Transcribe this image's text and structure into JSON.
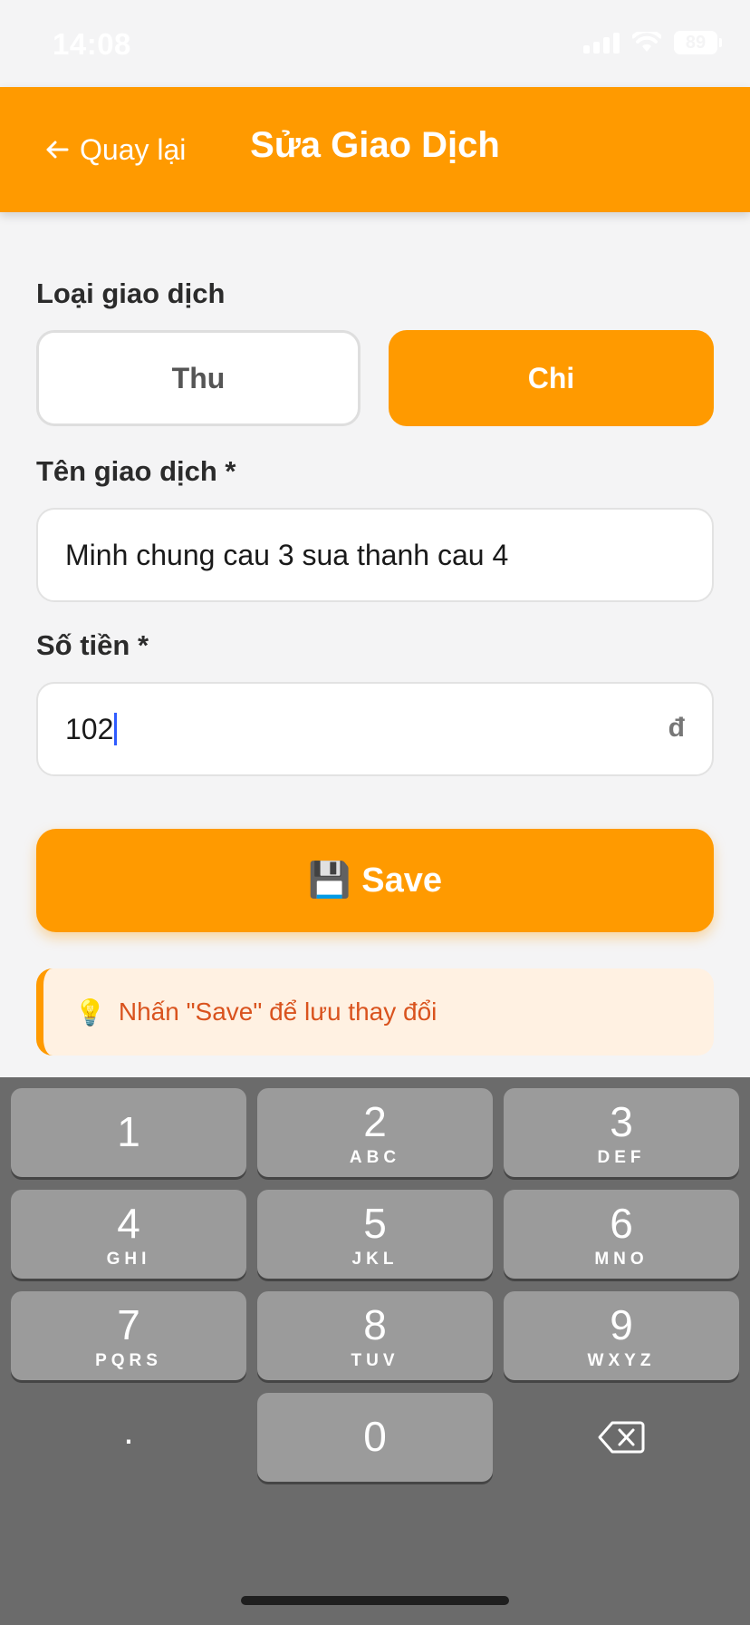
{
  "status_bar": {
    "time": "14:08",
    "battery": "89"
  },
  "header": {
    "back_label": "Quay lại",
    "title": "Sửa Giao Dịch"
  },
  "form": {
    "type_label": "Loại giao dịch",
    "type_options": [
      "Thu",
      "Chi"
    ],
    "type_selected": "Chi",
    "name_label": "Tên giao dịch *",
    "name_value": "Minh chung cau 3 sua thanh cau 4",
    "amount_label": "Số tiền *",
    "amount_value": "102",
    "currency_symbol": "đ"
  },
  "save_button": {
    "icon": "💾",
    "label": "Save"
  },
  "hint": {
    "icon": "💡",
    "text": "Nhấn \"Save\" để lưu thay đổi"
  },
  "keypad": {
    "keys": [
      {
        "num": "1",
        "letters": ""
      },
      {
        "num": "2",
        "letters": "ABC"
      },
      {
        "num": "3",
        "letters": "DEF"
      },
      {
        "num": "4",
        "letters": "GHI"
      },
      {
        "num": "5",
        "letters": "JKL"
      },
      {
        "num": "6",
        "letters": "MNO"
      },
      {
        "num": "7",
        "letters": "PQRS"
      },
      {
        "num": "8",
        "letters": "TUV"
      },
      {
        "num": "9",
        "letters": "WXYZ"
      },
      {
        "num": "0",
        "letters": ""
      }
    ],
    "decimal": "."
  },
  "colors": {
    "accent": "#ff9a00",
    "hint_text": "#d9531e",
    "keyboard_bg": "#6b6b6b"
  }
}
